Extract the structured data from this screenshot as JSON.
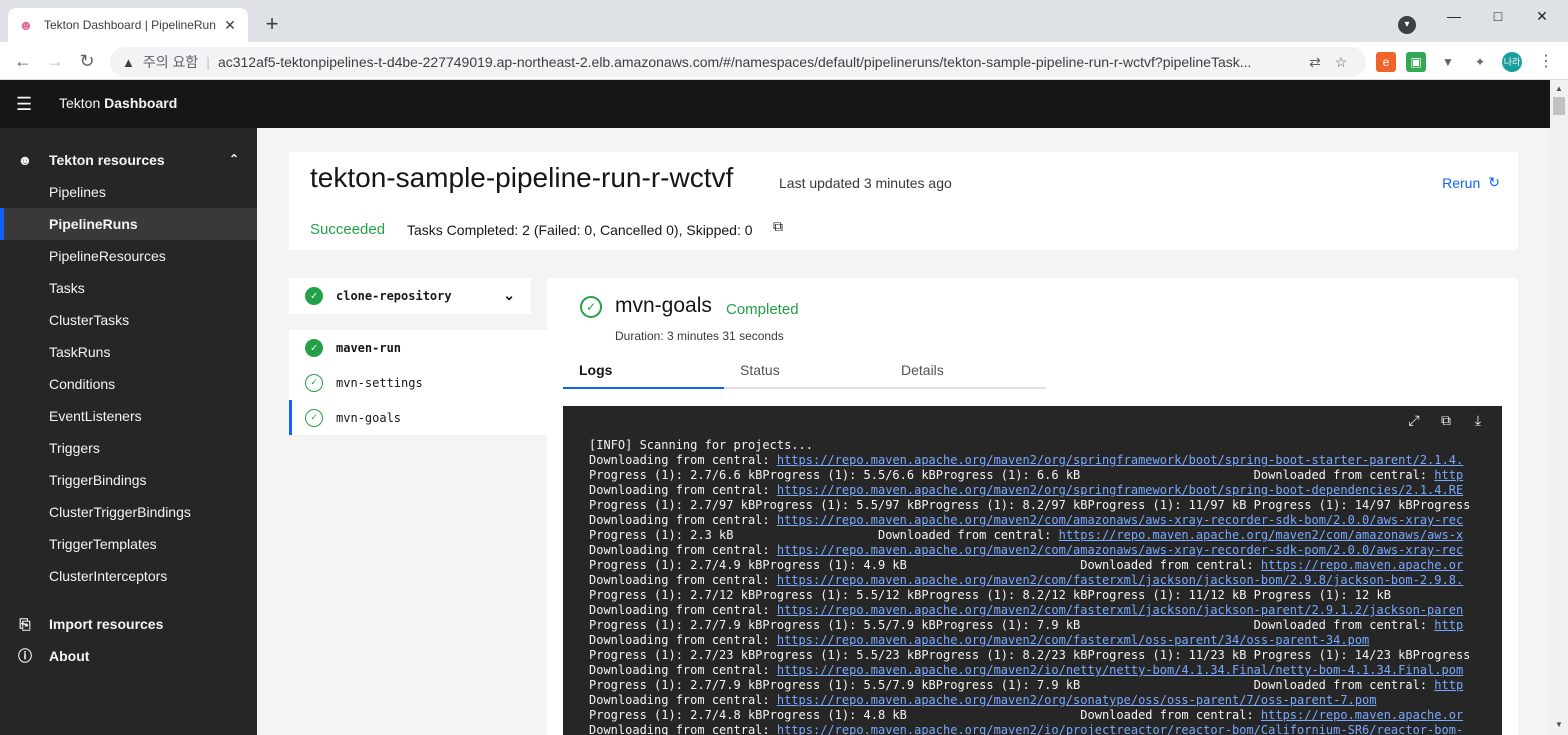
{
  "browser": {
    "tab_title": "Tekton Dashboard | PipelineRun",
    "new_tab": "+",
    "security_warning": "주의 요함",
    "url": "ac312af5-tektonpipelines-t-d4be-227749019.ap-northeast-2.elb.amazonaws.com/#/namespaces/default/pipelineruns/tekton-sample-pipeline-run-r-wctvf?pipelineTask...",
    "profile_label": "나라"
  },
  "app": {
    "brand_prefix": "Tekton",
    "brand_bold": "Dashboard"
  },
  "sidebar": {
    "section_title": "Tekton resources",
    "items": [
      {
        "label": "Pipelines"
      },
      {
        "label": "PipelineRuns"
      },
      {
        "label": "PipelineResources"
      },
      {
        "label": "Tasks"
      },
      {
        "label": "ClusterTasks"
      },
      {
        "label": "TaskRuns"
      },
      {
        "label": "Conditions"
      },
      {
        "label": "EventListeners"
      },
      {
        "label": "Triggers"
      },
      {
        "label": "TriggerBindings"
      },
      {
        "label": "ClusterTriggerBindings"
      },
      {
        "label": "TriggerTemplates"
      },
      {
        "label": "ClusterInterceptors"
      }
    ],
    "active_item": "PipelineRuns",
    "import_label": "Import resources",
    "about_label": "About"
  },
  "pipelinerun": {
    "name": "tekton-sample-pipeline-run-r-wctvf",
    "last_updated": "Last updated 3 minutes ago",
    "rerun_label": "Rerun",
    "status": "Succeeded",
    "tasks_summary": "Tasks Completed: 2 (Failed: 0, Cancelled 0), Skipped: 0"
  },
  "tasks": {
    "collapsed_task": "clone-repository",
    "expanded_task": "maven-run",
    "steps": [
      {
        "name": "mvn-settings"
      },
      {
        "name": "mvn-goals"
      }
    ]
  },
  "step_detail": {
    "name": "mvn-goals",
    "state": "Completed",
    "duration": "Duration: 3 minutes 31 seconds",
    "tabs": [
      "Logs",
      "Status",
      "Details"
    ],
    "active_tab": "Logs"
  },
  "logs": {
    "lines": [
      {
        "pre": "[INFO] Scanning for projects...",
        "link": "",
        "post": ""
      },
      {
        "pre": "Downloading from central: ",
        "link": "https://repo.maven.apache.org/maven2/org/springframework/boot/spring-boot-starter-parent/2.1.4.",
        "post": ""
      },
      {
        "pre": "Progress (1): 2.7/6.6 kBProgress (1): 5.5/6.6 kBProgress (1): 6.6 kB                        Downloaded from central: ",
        "link": "http",
        "post": ""
      },
      {
        "pre": "Downloading from central: ",
        "link": "https://repo.maven.apache.org/maven2/org/springframework/boot/spring-boot-dependencies/2.1.4.RE",
        "post": ""
      },
      {
        "pre": "Progress (1): 2.7/97 kBProgress (1): 5.5/97 kBProgress (1): 8.2/97 kBProgress (1): 11/97 kB Progress (1): 14/97 kBProgress",
        "link": "",
        "post": ""
      },
      {
        "pre": "Downloading from central: ",
        "link": "https://repo.maven.apache.org/maven2/com/amazonaws/aws-xray-recorder-sdk-bom/2.0.0/aws-xray-rec",
        "post": ""
      },
      {
        "pre": "Progress (1): 2.3 kB                    Downloaded from central: ",
        "link": "https://repo.maven.apache.org/maven2/com/amazonaws/aws-x",
        "post": ""
      },
      {
        "pre": "Downloading from central: ",
        "link": "https://repo.maven.apache.org/maven2/com/amazonaws/aws-xray-recorder-sdk-pom/2.0.0/aws-xray-rec",
        "post": ""
      },
      {
        "pre": "Progress (1): 2.7/4.9 kBProgress (1): 4.9 kB                        Downloaded from central: ",
        "link": "https://repo.maven.apache.or",
        "post": ""
      },
      {
        "pre": "Downloading from central: ",
        "link": "https://repo.maven.apache.org/maven2/com/fasterxml/jackson/jackson-bom/2.9.8/jackson-bom-2.9.8.",
        "post": ""
      },
      {
        "pre": "Progress (1): 2.7/12 kBProgress (1): 5.5/12 kBProgress (1): 8.2/12 kBProgress (1): 11/12 kB Progress (1): 12 kB",
        "link": "",
        "post": ""
      },
      {
        "pre": "Downloading from central: ",
        "link": "https://repo.maven.apache.org/maven2/com/fasterxml/jackson/jackson-parent/2.9.1.2/jackson-paren",
        "post": ""
      },
      {
        "pre": "Progress (1): 2.7/7.9 kBProgress (1): 5.5/7.9 kBProgress (1): 7.9 kB                        Downloaded from central: ",
        "link": "http",
        "post": ""
      },
      {
        "pre": "Downloading from central: ",
        "link": "https://repo.maven.apache.org/maven2/com/fasterxml/oss-parent/34/oss-parent-34.pom",
        "post": ""
      },
      {
        "pre": "Progress (1): 2.7/23 kBProgress (1): 5.5/23 kBProgress (1): 8.2/23 kBProgress (1): 11/23 kB Progress (1): 14/23 kBProgress",
        "link": "",
        "post": ""
      },
      {
        "pre": "Downloading from central: ",
        "link": "https://repo.maven.apache.org/maven2/io/netty/netty-bom/4.1.34.Final/netty-bom-4.1.34.Final.pom",
        "post": ""
      },
      {
        "pre": "Progress (1): 2.7/7.9 kBProgress (1): 5.5/7.9 kBProgress (1): 7.9 kB                        Downloaded from central: ",
        "link": "http",
        "post": ""
      },
      {
        "pre": "Downloading from central: ",
        "link": "https://repo.maven.apache.org/maven2/org/sonatype/oss/oss-parent/7/oss-parent-7.pom",
        "post": ""
      },
      {
        "pre": "Progress (1): 2.7/4.8 kBProgress (1): 4.8 kB                        Downloaded from central: ",
        "link": "https://repo.maven.apache.or",
        "post": ""
      },
      {
        "pre": "Downloading from central: ",
        "link": "https://repo.maven.apache.org/maven2/io/projectreactor/reactor-bom/Californium-SR6/reactor-bom-",
        "post": ""
      }
    ]
  },
  "colors": {
    "accent": "#0f62fe",
    "success": "#24a148",
    "header_bg": "#161616",
    "sidebar_bg": "#262626",
    "log_bg": "#262626",
    "link": "#78a9ff"
  },
  "icons": {
    "favicon": "tekton-robot-icon",
    "resources": "tekton-robot-icon",
    "import": "document-import-icon",
    "about": "info-icon"
  }
}
